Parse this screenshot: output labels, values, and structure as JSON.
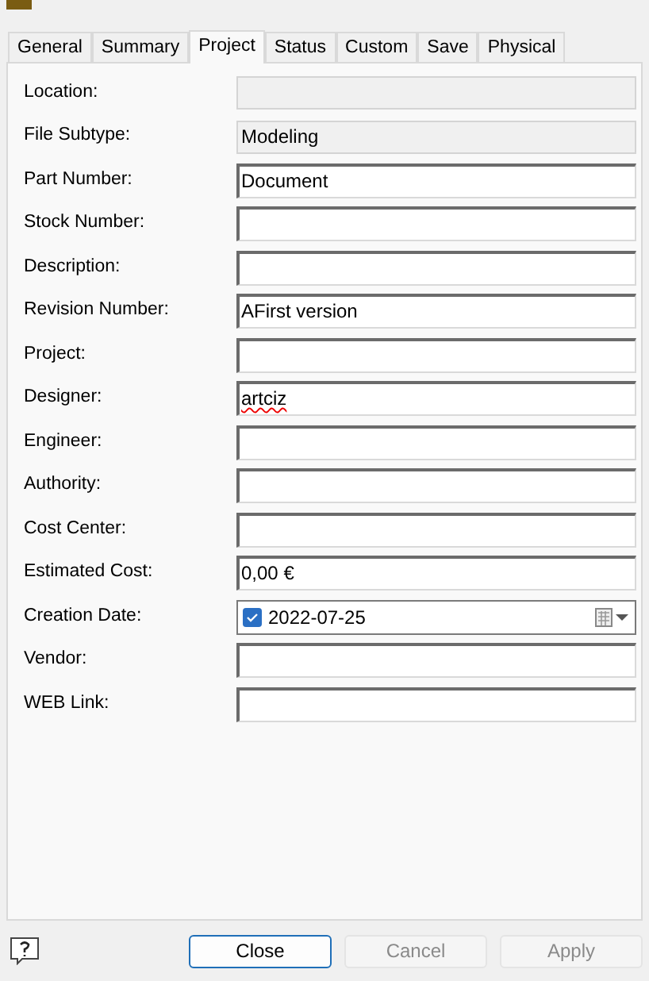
{
  "tabs": [
    {
      "label": "General",
      "selected": false
    },
    {
      "label": "Summary",
      "selected": false
    },
    {
      "label": "Project",
      "selected": true
    },
    {
      "label": "Status",
      "selected": false
    },
    {
      "label": "Custom",
      "selected": false
    },
    {
      "label": "Save",
      "selected": false
    },
    {
      "label": "Physical",
      "selected": false
    }
  ],
  "fields": [
    {
      "label": "Location:",
      "kind": "readonly"
    },
    {
      "label": "File Subtype:",
      "kind": "readonly",
      "value": "Modeling"
    },
    {
      "label": "Part Number:",
      "kind": "text",
      "value": "Document"
    },
    {
      "label": "Stock Number:",
      "kind": "text"
    },
    {
      "label": "Description:",
      "kind": "text"
    },
    {
      "label": "Revision Number:",
      "kind": "text",
      "value": "AFirst version"
    },
    {
      "label": "Project:",
      "kind": "text"
    },
    {
      "label": "Designer:",
      "kind": "text",
      "value": "artciz",
      "misspelled": true
    },
    {
      "label": "Engineer:",
      "kind": "text"
    },
    {
      "label": "Authority:",
      "kind": "text"
    },
    {
      "label": "Cost Center:",
      "kind": "text"
    },
    {
      "label": "Estimated Cost:",
      "kind": "text",
      "value": "0,00 €"
    },
    {
      "label": "Creation Date:",
      "kind": "date",
      "value": "2022-07-25",
      "checked": true
    },
    {
      "label": "Vendor:",
      "kind": "text"
    },
    {
      "label": "WEB Link:",
      "kind": "text"
    }
  ],
  "buttons": [
    {
      "label": "Close",
      "disabled": false
    },
    {
      "label": "Cancel",
      "disabled": true
    },
    {
      "label": "Apply",
      "disabled": true
    }
  ]
}
